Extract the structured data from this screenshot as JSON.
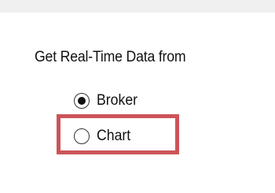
{
  "group": {
    "label": "Get Real-Time Data from"
  },
  "options": [
    {
      "label": "Broker",
      "selected": true
    },
    {
      "label": "Chart",
      "selected": false
    }
  ],
  "highlight": {
    "color": "#cc5458",
    "target": "Chart"
  }
}
